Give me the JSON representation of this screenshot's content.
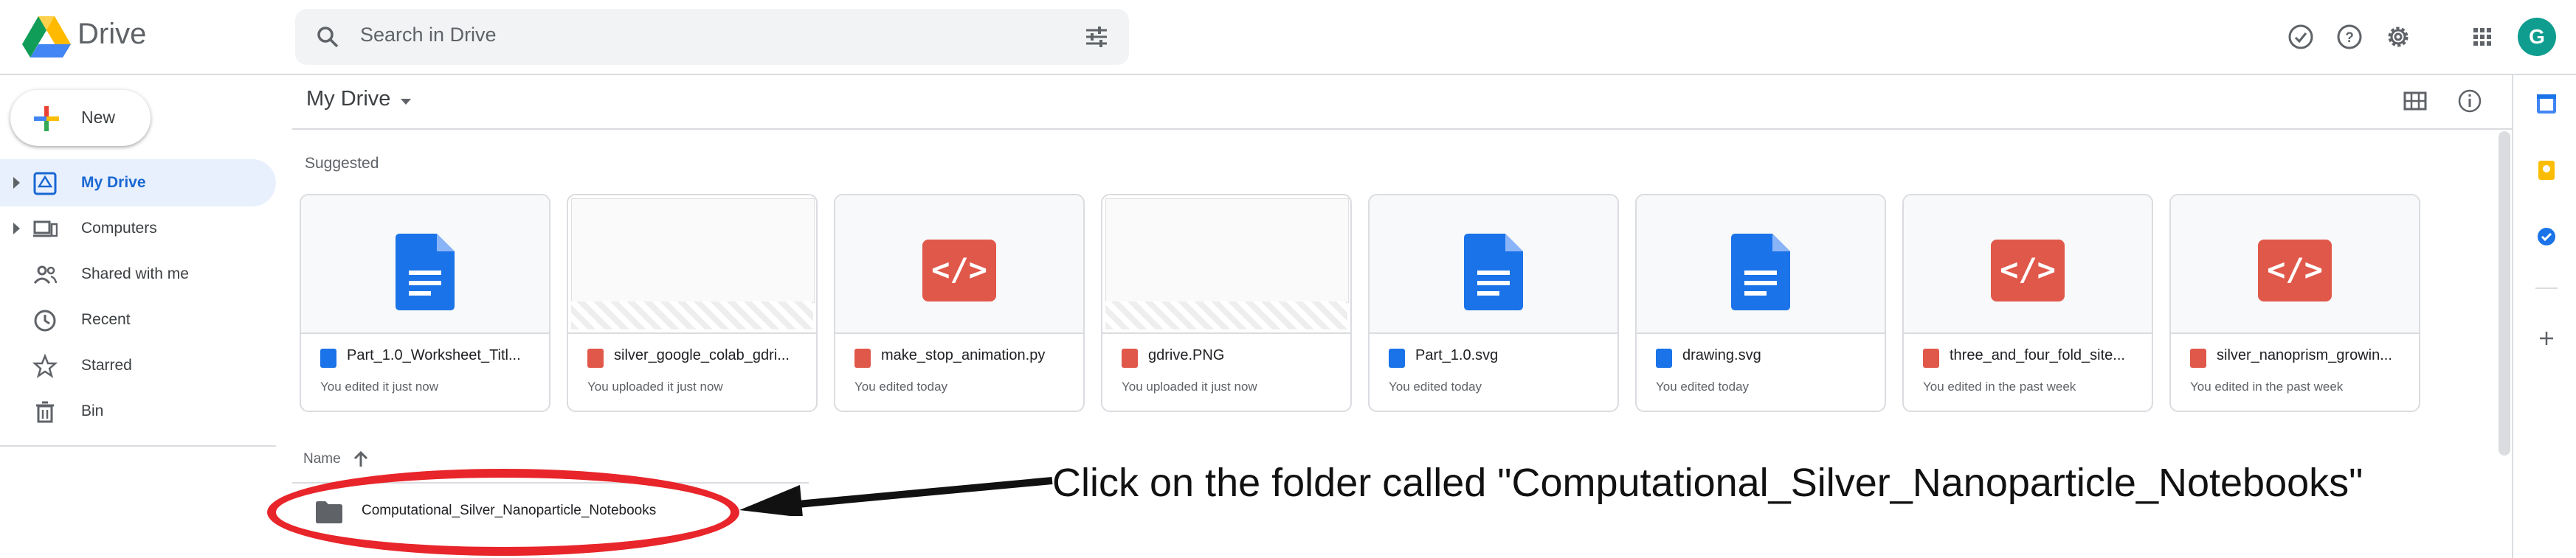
{
  "app": {
    "title": "Drive"
  },
  "search": {
    "placeholder": "Search in Drive"
  },
  "header": {
    "avatar_letter": "G"
  },
  "sidebar": {
    "new_label": "New",
    "items": [
      {
        "label": "My Drive",
        "icon": "my-drive-icon",
        "active": true
      },
      {
        "label": "Computers",
        "icon": "computers-icon"
      },
      {
        "label": "Shared with me",
        "icon": "shared-with-me-icon"
      },
      {
        "label": "Recent",
        "icon": "recent-clock-icon"
      },
      {
        "label": "Starred",
        "icon": "star-icon"
      },
      {
        "label": "Bin",
        "icon": "bin-icon"
      }
    ]
  },
  "main": {
    "breadcrumb": "My Drive",
    "suggested_label": "Suggested",
    "name_header": "Name",
    "suggested": [
      {
        "name": "Part_1.0_Worksheet_Titl...",
        "subtitle": "You edited it just now",
        "type": "doc"
      },
      {
        "name": "silver_google_colab_gdri...",
        "subtitle": "You uploaded it just now",
        "type": "image"
      },
      {
        "name": "make_stop_animation.py",
        "subtitle": "You edited today",
        "type": "code"
      },
      {
        "name": "gdrive.PNG",
        "subtitle": "You uploaded it just now",
        "type": "image"
      },
      {
        "name": "Part_1.0.svg",
        "subtitle": "You edited today",
        "type": "doc"
      },
      {
        "name": "drawing.svg",
        "subtitle": "You edited today",
        "type": "doc"
      },
      {
        "name": "three_and_four_fold_site...",
        "subtitle": "You edited in the past week",
        "type": "code"
      },
      {
        "name": "silver_nanoprism_growin...",
        "subtitle": "You edited in the past week",
        "type": "code"
      }
    ],
    "folders": [
      {
        "name": "Computational_Silver_Nanoparticle_Notebooks"
      }
    ]
  },
  "annotation": {
    "text": "Click on the folder called \"Computational_Silver_Nanoparticle_Notebooks\""
  },
  "colors": {
    "accent": "#1a73e8",
    "active_bg": "#e8f0fe",
    "doc_blue": "#1a73e8",
    "code_red": "#e0584a",
    "annotation_red": "#e8252a"
  }
}
